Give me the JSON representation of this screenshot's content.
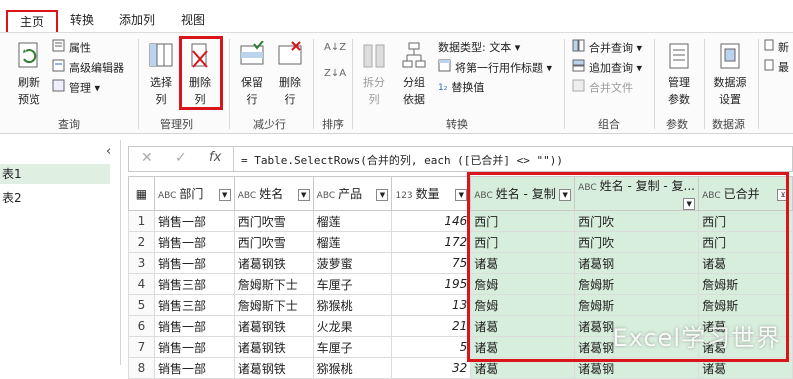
{
  "tabs": [
    "主页",
    "转换",
    "添加列",
    "视图"
  ],
  "ribbon": {
    "refresh": "刷新\n预览",
    "properties": "属性",
    "advanced_editor": "高级编辑器",
    "manage": "管理",
    "choose_cols": "选择\n列",
    "remove_cols": "删除\n列",
    "keep_rows": "保留\n行",
    "remove_rows": "删除\n行",
    "split_col": "拆分\n列",
    "group_by": "分组\n依据",
    "data_type": "数据类型: 文本",
    "first_row_header": "将第一行用作标题",
    "replace_values": "替换值",
    "merge_queries": "合并查询",
    "append_queries": "追加查询",
    "combine_files": "合并文件",
    "manage_params": "管理\n参数",
    "data_source": "数据源\n设置",
    "new_source": "新",
    "recent": "最",
    "groups": [
      "查询",
      "管理列",
      "减少行",
      "排序",
      "转换",
      "组合",
      "参数",
      "数据源"
    ]
  },
  "leftnav": {
    "items": [
      "表1",
      "表2"
    ]
  },
  "formula": {
    "x": "✕",
    "check": "✓",
    "fx": "fx",
    "text": "= Table.SelectRows(合并的列, each ([已合并] <> \"\"))"
  },
  "table": {
    "headers": [
      {
        "type": "ABC",
        "name": "部门"
      },
      {
        "type": "ABC",
        "name": "姓名"
      },
      {
        "type": "ABC",
        "name": "产品"
      },
      {
        "type": "123",
        "name": "数量"
      },
      {
        "type": "ABC",
        "name": "姓名 - 复制"
      },
      {
        "type": "ABC",
        "name": "姓名 - 复制 - 复..."
      },
      {
        "type": "ABC",
        "name": "已合并"
      }
    ],
    "rows": [
      [
        "1",
        "销售一部",
        "西门吹雪",
        "榴莲",
        "146",
        "西门",
        "西门吹",
        "西门"
      ],
      [
        "2",
        "销售一部",
        "西门吹雪",
        "榴莲",
        "172",
        "西门",
        "西门吹",
        "西门"
      ],
      [
        "3",
        "销售一部",
        "诸葛钢铁",
        "菠萝蜜",
        "75",
        "诸葛",
        "诸葛钢",
        "诸葛"
      ],
      [
        "4",
        "销售三部",
        "詹姆斯下士",
        "车厘子",
        "195",
        "詹姆",
        "詹姆斯",
        "詹姆斯"
      ],
      [
        "5",
        "销售三部",
        "詹姆斯下士",
        "猕猴桃",
        "13",
        "詹姆",
        "詹姆斯",
        "詹姆斯"
      ],
      [
        "6",
        "销售一部",
        "诸葛钢铁",
        "火龙果",
        "21",
        "诸葛",
        "诸葛钢",
        "诸葛"
      ],
      [
        "7",
        "销售一部",
        "诸葛钢铁",
        "车厘子",
        "5",
        "诸葛",
        "诸葛钢",
        "诸葛"
      ],
      [
        "8",
        "销售一部",
        "诸葛钢铁",
        "猕猴桃",
        "32",
        "诸葛",
        "诸葛钢",
        "诸葛"
      ]
    ]
  },
  "watermark": "Excel学习世界",
  "colors": {
    "accent_red": "#d9151b",
    "highlight_green": "#d8eedc"
  }
}
